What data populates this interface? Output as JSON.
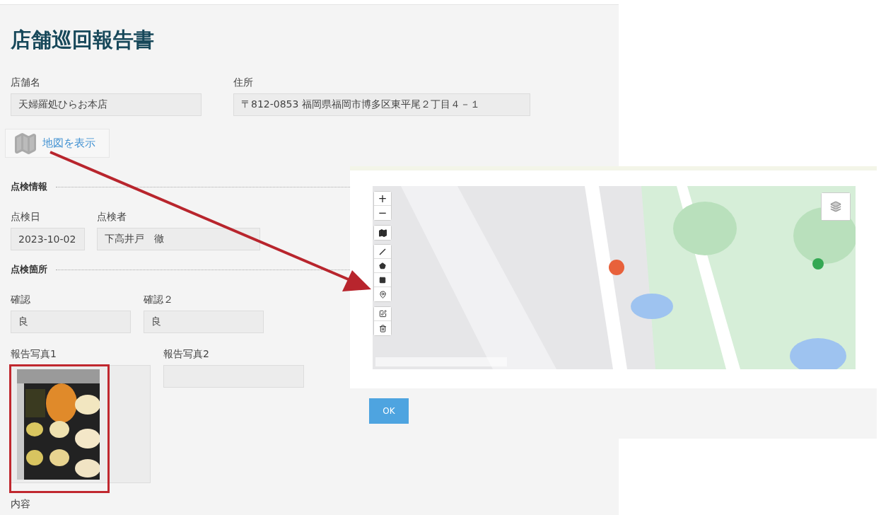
{
  "title": "店舗巡回報告書",
  "store_fields": [
    {
      "label": "店舗名",
      "value": "天婦羅処ひらお本店"
    },
    {
      "label": "住所",
      "value": "〒812-0853 福岡県福岡市博多区東平尾２丁目４－１"
    }
  ],
  "map_button": {
    "label": "地図を表示"
  },
  "sections": [
    {
      "heading": "点検情報",
      "fields": [
        {
          "label": "点検日",
          "value": "2023-10-02"
        },
        {
          "label": "点検者",
          "value": "下高井戸　徹"
        }
      ]
    },
    {
      "heading": "点検箇所",
      "fields": [
        {
          "label": "確認",
          "value": "良"
        },
        {
          "label": "確認２",
          "value": "良"
        }
      ]
    }
  ],
  "photos": [
    {
      "label": "報告写真1",
      "kind": "picture",
      "highlighted": true
    },
    {
      "label": "報告写真2",
      "kind": "empty",
      "highlighted": false
    }
  ],
  "content_label": "内容",
  "map_dialog": {
    "zoom_controls": [
      "+",
      "−"
    ],
    "ok_button": "OK"
  }
}
